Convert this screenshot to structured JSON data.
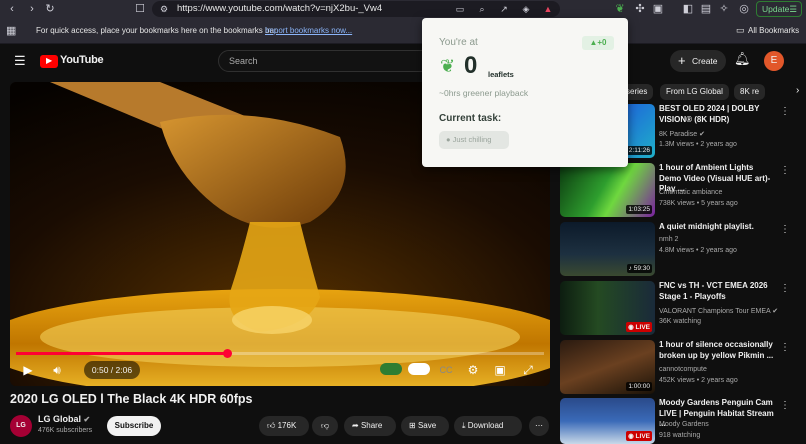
{
  "browser": {
    "url": "https://www.youtube.com/watch?v=njX2bu-_Vw4",
    "update_label": "Update",
    "bookmarks_message": "For quick access, place your bookmarks here on the bookmarks bar.",
    "import_link": "Import bookmarks now...",
    "all_bookmarks": "All Bookmarks"
  },
  "header": {
    "logo_text": "YouTube",
    "search_placeholder": "Search",
    "create_label": "Create",
    "avatar_letter": "E"
  },
  "player": {
    "time": "0/50 / 2:06",
    "time_display": "0:50 / 2:06",
    "progress": 0.4
  },
  "video": {
    "title": "2020 LG OLED l The Black 4K HDR 60fps",
    "channel_logo": "LG",
    "channel_name": "LG Global",
    "subscribers": "476K subscribers",
    "subscribe_label": "Subscribe",
    "likes": "176K",
    "share_label": "Share",
    "save_label": "Save",
    "download_label": "Download"
  },
  "chips": [
    "series",
    "From LG Global",
    "8K re"
  ],
  "recommendations": [
    {
      "title": "BEST OLED 2024 | DOLBY VISION® (8K HDR)",
      "channel": "8K Paradise",
      "verified": true,
      "meta": "1.3M views • 2 years ago",
      "duration": "2:11:26",
      "live": false
    },
    {
      "title": "1 hour of Ambient Lights Demo Video (Visual HUE art)- Play ...",
      "channel": "Cinematic ambiance",
      "verified": false,
      "meta": "738K views • 5 years ago",
      "duration": "1:03:25",
      "live": false
    },
    {
      "title": "A quiet midnight playlist.",
      "channel": "nmh 2",
      "verified": false,
      "meta": "4.8M views • 2 years ago",
      "duration": "59:30",
      "live": false
    },
    {
      "title": "FNC vs TH - VCT EMEA 2026 Stage 1 - Playoffs",
      "channel": "VALORANT Champions Tour EMEA",
      "verified": true,
      "meta": "36K watching",
      "duration": "LIVE",
      "live": true
    },
    {
      "title": "1 hour of silence occasionally broken up by yellow Pikmin ...",
      "channel": "cannotcompute",
      "verified": false,
      "meta": "452K views • 2 years ago",
      "duration": "1:00:00",
      "live": false
    },
    {
      "title": "Moody Gardens Penguin Cam LIVE | Penguin Habitat Stream ...",
      "channel": "Moody Gardens",
      "verified": false,
      "meta": "918 watching",
      "duration": "LIVE",
      "live": true
    }
  ],
  "popup": {
    "youre_at": "You're at",
    "badge": "▲+0",
    "count": "0",
    "unit": "leaflets",
    "greener": "~0hrs greener playback",
    "task_label": "Current task:",
    "task_value": "Just chilling"
  }
}
